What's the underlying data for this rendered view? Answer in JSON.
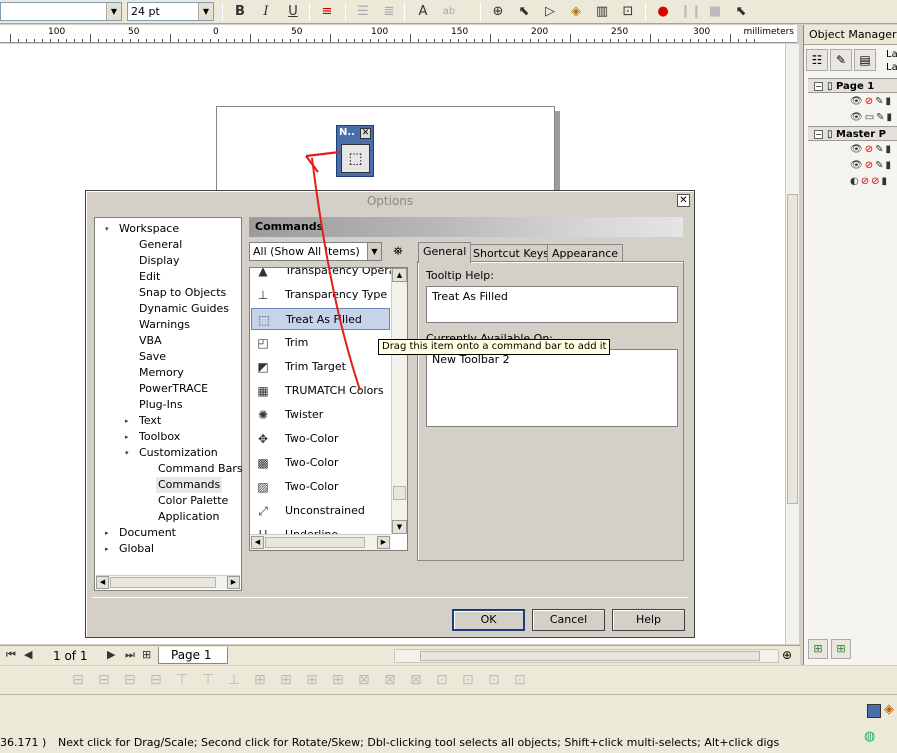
{
  "toolbar": {
    "font_size_value": "24 pt",
    "buttons": [
      {
        "name": "bold-button",
        "glyph": "B"
      },
      {
        "name": "italic-button",
        "glyph": "I"
      },
      {
        "name": "underline-button",
        "glyph": "U"
      }
    ]
  },
  "ruler": {
    "unit": "millimeters",
    "labels": [
      "100",
      "50",
      "0",
      "50",
      "100",
      "150",
      "200",
      "250",
      "300"
    ]
  },
  "mini_toolbar": {
    "title": "N.."
  },
  "object_manager": {
    "title": "Object Manager",
    "la1": "La",
    "la2": "La",
    "page1": "Page 1",
    "master": "Master P"
  },
  "pagebar": {
    "page_count": "1 of 1",
    "page_tab": "Page 1"
  },
  "status": {
    "coords": "36.171 )",
    "message": "Next click for Drag/Scale; Second click for Rotate/Skew; Dbl-clicking tool selects all objects; Shift+click multi-selects; Alt+click digs"
  },
  "dialog": {
    "title": "Options",
    "tree": [
      {
        "label": "Workspace",
        "level": 0,
        "expander": "minus"
      },
      {
        "label": "General",
        "level": 1
      },
      {
        "label": "Display",
        "level": 1
      },
      {
        "label": "Edit",
        "level": 1
      },
      {
        "label": "Snap to Objects",
        "level": 1
      },
      {
        "label": "Dynamic Guides",
        "level": 1
      },
      {
        "label": "Warnings",
        "level": 1
      },
      {
        "label": "VBA",
        "level": 1
      },
      {
        "label": "Save",
        "level": 1
      },
      {
        "label": "Memory",
        "level": 1
      },
      {
        "label": "PowerTRACE",
        "level": 1
      },
      {
        "label": "Plug-Ins",
        "level": 1
      },
      {
        "label": "Text",
        "level": 1,
        "expander": "plus"
      },
      {
        "label": "Toolbox",
        "level": 1,
        "expander": "plus"
      },
      {
        "label": "Customization",
        "level": 1,
        "expander": "minus"
      },
      {
        "label": "Command Bars",
        "level": 2
      },
      {
        "label": "Commands",
        "level": 2,
        "selected": true
      },
      {
        "label": "Color Palette",
        "level": 2
      },
      {
        "label": "Application",
        "level": 2
      },
      {
        "label": "Document",
        "level": 0,
        "expander": "plus"
      },
      {
        "label": "Global",
        "level": 0,
        "expander": "plus"
      }
    ],
    "section_title": "Commands",
    "filter_value": "All (Show All Items)",
    "commands": [
      {
        "label": "Transparency Operat",
        "icon": "transparency-operation-icon",
        "glyph": "▲"
      },
      {
        "label": "Transparency Type",
        "icon": "transparency-type-icon",
        "glyph": "⊥"
      },
      {
        "label": "Treat As Filled",
        "icon": "treat-as-filled-icon",
        "glyph": "⬚",
        "selected": true
      },
      {
        "label": "Trim",
        "icon": "trim-icon",
        "glyph": "◰"
      },
      {
        "label": "Trim Target",
        "icon": "trim-target-icon",
        "glyph": "◩"
      },
      {
        "label": "TRUMATCH Colors",
        "icon": "trumatch-colors-icon",
        "glyph": "▦"
      },
      {
        "label": "Twister",
        "icon": "twister-icon",
        "glyph": "✺"
      },
      {
        "label": "Two-Color",
        "icon": "two-color-pattern-icon",
        "glyph": "✥"
      },
      {
        "label": "Two-Color",
        "icon": "two-color-fill-icon",
        "glyph": "▩"
      },
      {
        "label": "Two-Color",
        "icon": "two-color-bitmap-icon",
        "glyph": "▨"
      },
      {
        "label": "Unconstrained",
        "icon": "unconstrained-icon",
        "glyph": "⤢"
      },
      {
        "label": "Underline",
        "icon": "underline-command-icon",
        "glyph": "U"
      }
    ],
    "tabs": [
      "General",
      "Shortcut Keys",
      "Appearance"
    ],
    "tooltip_help_label": "Tooltip Help:",
    "tooltip_help_value": "Treat As Filled",
    "available_on_label": "Currently Available On:",
    "available_on_value": "New Toolbar 2",
    "buttons": {
      "ok": "OK",
      "cancel": "Cancel",
      "help": "Help"
    }
  },
  "tooltip": "Drag this item onto a command bar to add it",
  "colors": {
    "selection": "#c7d3e8",
    "titlebar_blue": "#4a6ea8",
    "arrow_red": "#e0201c"
  }
}
